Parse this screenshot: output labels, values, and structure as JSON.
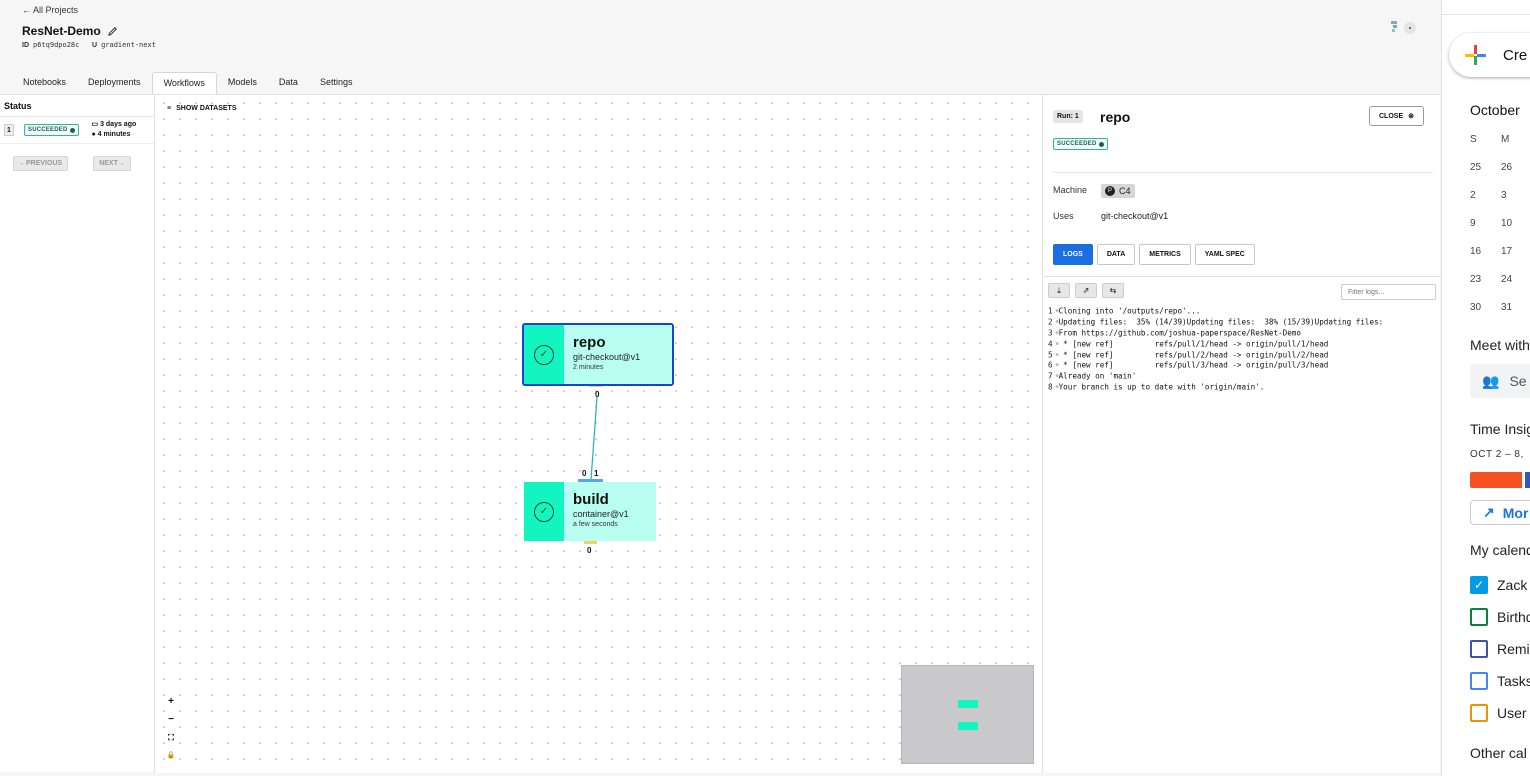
{
  "header": {
    "back_link": "← All Projects",
    "project_name": "ResNet-Demo",
    "id_label": "ID",
    "project_id": "p6tq9dpo28c",
    "user_label": "U",
    "user_name": "gradient-next"
  },
  "tabs": [
    "Notebooks",
    "Deployments",
    "Workflows",
    "Models",
    "Data",
    "Settings"
  ],
  "active_tab": "Workflows",
  "status_panel": {
    "heading": "Status",
    "runs": [
      {
        "number": "1",
        "status": "SUCCEEDED",
        "started": "3 days ago",
        "duration": "4 minutes"
      }
    ],
    "prev_label": "←PREVIOUS",
    "next_label": "NEXT→"
  },
  "canvas": {
    "show_datasets_label": "SHOW DATASETS",
    "nodes": [
      {
        "name": "repo",
        "uses": "git-checkout@v1",
        "duration": "2 minutes",
        "selected": true
      },
      {
        "name": "build",
        "uses": "container@v1",
        "duration": "a few seconds",
        "selected": false
      }
    ],
    "ports": {
      "repo_out": "0",
      "build_in_a": "0",
      "build_in_b": "1",
      "build_out": "0"
    },
    "controls": [
      "+",
      "−",
      "⛶",
      "🔒"
    ]
  },
  "detail": {
    "run_label": "Run: 1",
    "title": "repo",
    "close_label": "CLOSE",
    "status": "SUCCEEDED",
    "machine_label": "Machine",
    "machine_value": "C4",
    "uses_label": "Uses",
    "uses_value": "git-checkout@v1",
    "tabs": [
      "LOGS",
      "DATA",
      "METRICS",
      "YAML SPEC"
    ],
    "active_tab": "LOGS",
    "filter_placeholder": "Filter logs...",
    "logs": [
      {
        "n": "1",
        "text": "Cloning into '/outputs/repo'..."
      },
      {
        "n": "2",
        "text": "Updating files:  35% (14/39)Updating files:  38% (15/39)Updating files:"
      },
      {
        "n": "3",
        "text": "From https://github.com/joshua-paperspace/ResNet-Demo"
      },
      {
        "n": "4",
        "text": " * [new ref]         refs/pull/1/head -> origin/pull/1/head"
      },
      {
        "n": "5",
        "text": " * [new ref]         refs/pull/2/head -> origin/pull/2/head"
      },
      {
        "n": "6",
        "text": " * [new ref]         refs/pull/3/head -> origin/pull/3/head"
      },
      {
        "n": "7",
        "text": "Already on 'main'"
      },
      {
        "n": "8",
        "text": "Your branch is up to date with 'origin/main'."
      }
    ]
  },
  "calendar": {
    "create_label": "Cre",
    "month": "October",
    "weekdays": [
      "S",
      "M"
    ],
    "weeks": [
      [
        "25",
        "26"
      ],
      [
        "2",
        "3"
      ],
      [
        "9",
        "10"
      ],
      [
        "16",
        "17"
      ],
      [
        "23",
        "24"
      ],
      [
        "30",
        "31"
      ]
    ],
    "meet_heading": "Meet with",
    "people_search": "Se",
    "time_insights_heading": "Time Insig",
    "insights_range": "OCT 2 – 8,",
    "more_label": "Mor",
    "my_calendars_heading": "My calend",
    "my_calendars": [
      {
        "label": "Zack",
        "color": "#039be5",
        "checked": true
      },
      {
        "label": "Birthd",
        "color": "#0b8043",
        "checked": false
      },
      {
        "label": "Remin",
        "color": "#3f51b5",
        "checked": false
      },
      {
        "label": "Tasks",
        "color": "#4285f4",
        "checked": false
      },
      {
        "label": "User",
        "color": "#f09300",
        "checked": false
      }
    ],
    "other_calendars_heading": "Other cal"
  }
}
